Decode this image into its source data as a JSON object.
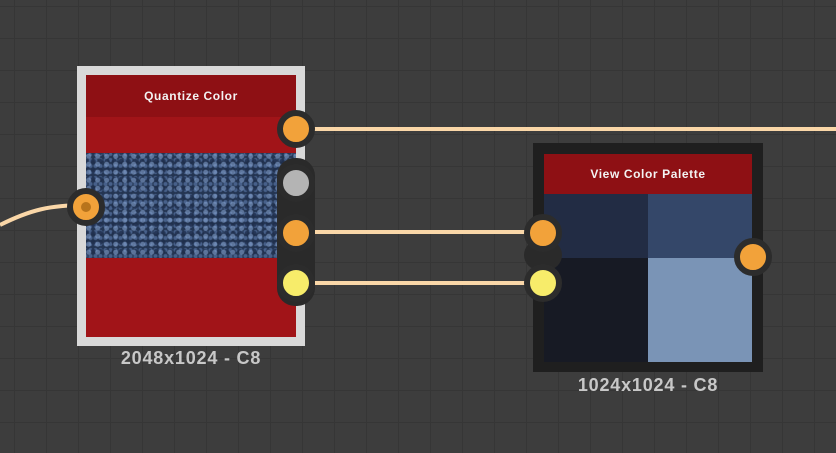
{
  "graph": {
    "nodes": [
      {
        "id": "quantize",
        "title": "Quantize Color",
        "caption": "2048x1024 - C8"
      },
      {
        "id": "palette",
        "title": "View Color Palette",
        "caption": "1024x1024 - C8",
        "swatches": [
          "#222c44",
          "#344769",
          "#171a24",
          "#7a94b6"
        ]
      }
    ],
    "colors": {
      "canvas": "#3d3d3d",
      "node_header": "#8e1014",
      "node_body": "#a11418",
      "wire": "#fad7a8",
      "port_orange": "#f2a23a",
      "port_gray": "#b4b4b4",
      "port_yellow": "#f7ec6a"
    },
    "ports": {
      "quantize_input": "orange",
      "quantize_outputs": [
        "orange",
        "gray",
        "orange",
        "yellow"
      ],
      "palette_inputs": [
        "orange",
        "yellow"
      ],
      "palette_output": "orange"
    }
  }
}
